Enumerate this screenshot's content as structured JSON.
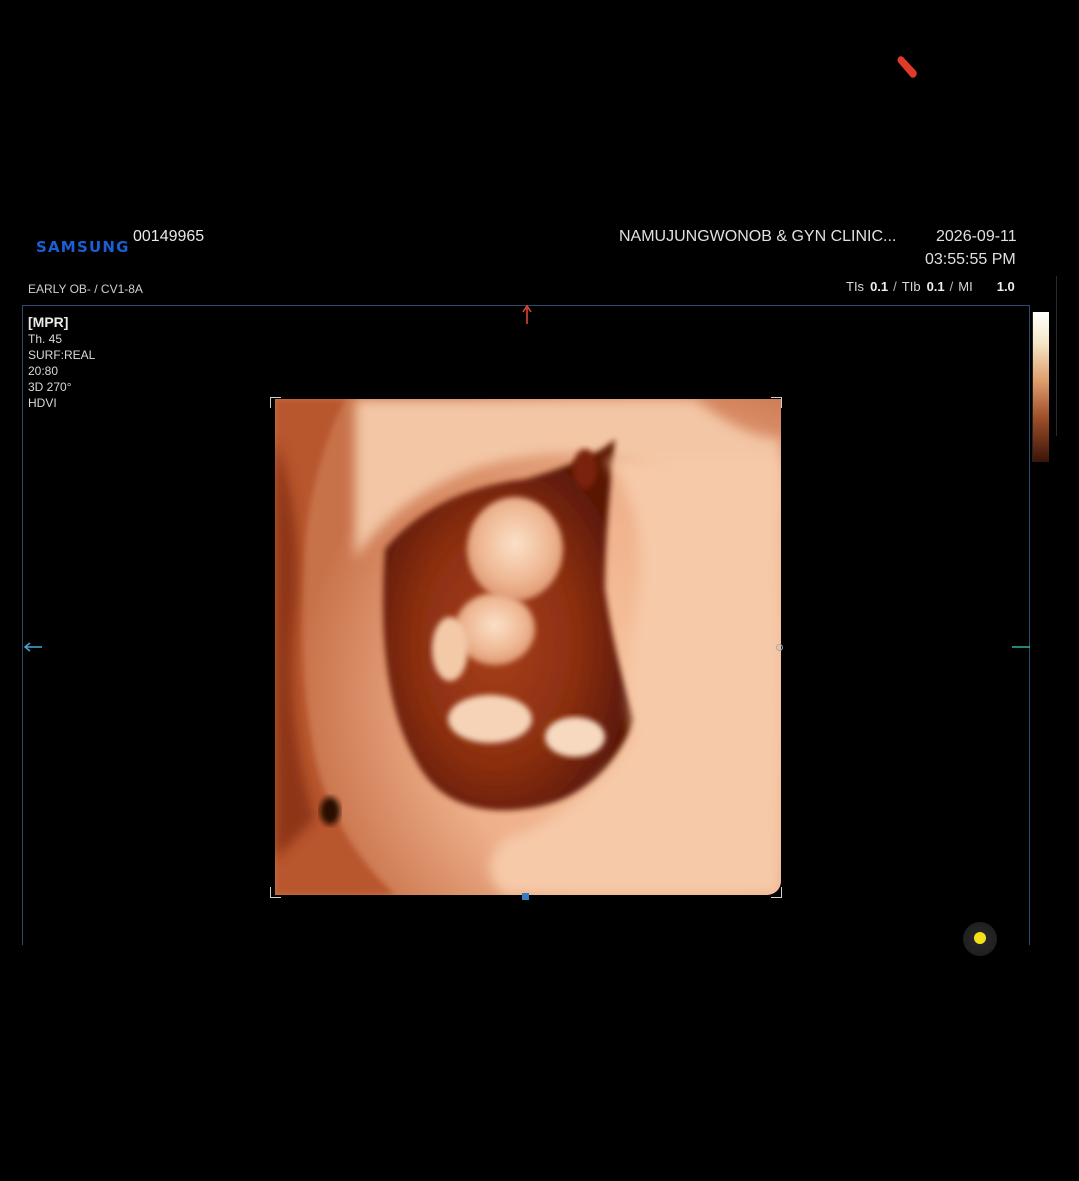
{
  "header": {
    "brand": "SAMSUNG",
    "patient_id": "00149965",
    "clinic": "NAMUJUNGWONOB & GYN CLINIC...",
    "date": "2026-09-11",
    "time": "03:55:55 PM",
    "preset_probe": "EARLY OB- / CV1-8A"
  },
  "indices": {
    "tis_label": "TIs",
    "tis_value": "0.1",
    "tib_label": "TIb",
    "tib_value": "0.1",
    "mi_label": "MI",
    "mi_value": "1.0",
    "separator": "/"
  },
  "params": {
    "mode": "[MPR]",
    "thickness": "Th. 45",
    "surface": "SURF:REAL",
    "ratio": "20:80",
    "rotation": "3D 270°",
    "render": "HDVI"
  },
  "icons": {
    "corner_mark": "red-marker-icon",
    "orient_top": "arrow-up-icon",
    "orient_left": "arrow-left-icon",
    "orient_right": "arrow-right-icon",
    "status": "status-dot-icon"
  },
  "colors": {
    "brand": "#1a5fd6",
    "frame": "#2d4a6e",
    "marker": "#e23a2a",
    "status": "#f4e11a"
  }
}
